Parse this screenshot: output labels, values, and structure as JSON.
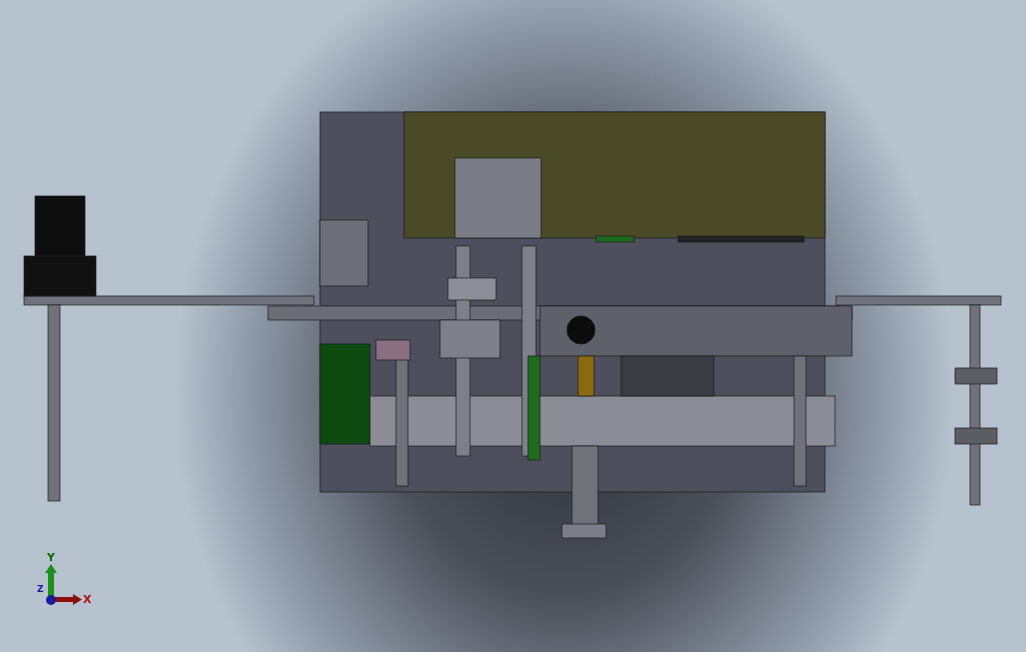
{
  "triad": {
    "axes": [
      {
        "kind": "vertical",
        "label": "Y",
        "color": "#1f8f1f"
      },
      {
        "kind": "horizontal",
        "label": "X",
        "color": "#8a1010"
      },
      {
        "kind": "depth",
        "label": "Z",
        "color": "#1a1a9a"
      }
    ]
  }
}
